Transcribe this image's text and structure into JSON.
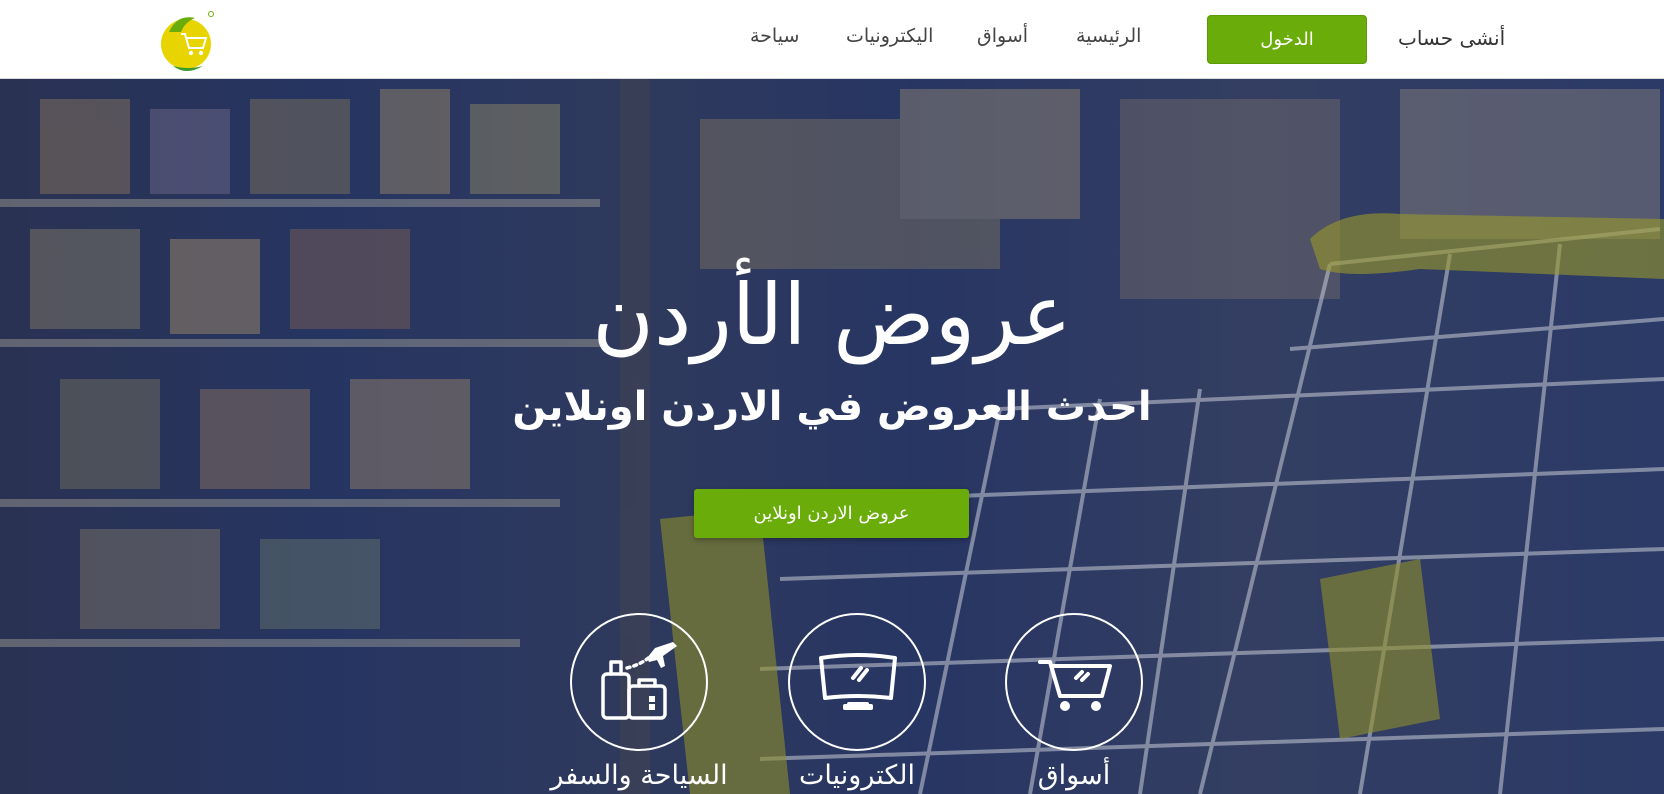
{
  "header": {
    "logo_icon": "cart-leaf-logo",
    "nav": [
      {
        "label": "الرئيسية"
      },
      {
        "label": "أسواق"
      },
      {
        "label": "اليكترونيات"
      },
      {
        "label": "سياحة"
      }
    ],
    "login_label": "الدخول",
    "signup_label": "أنشى حساب"
  },
  "hero": {
    "title": "عروض الأردن",
    "subtitle": "احدث العروض في الاردن اونلاين",
    "cta_label": "عروض الاردن اونلاين",
    "categories": [
      {
        "label": "أسواق",
        "icon": "shopping-cart-icon"
      },
      {
        "label": "الكترونيات",
        "icon": "tv-icon"
      },
      {
        "label": "السياحة والسفر",
        "icon": "travel-luggage-icon"
      }
    ]
  },
  "colors": {
    "accent": "#6aac09",
    "overlay": "#1e2d5f",
    "text_light": "#ffffff"
  }
}
